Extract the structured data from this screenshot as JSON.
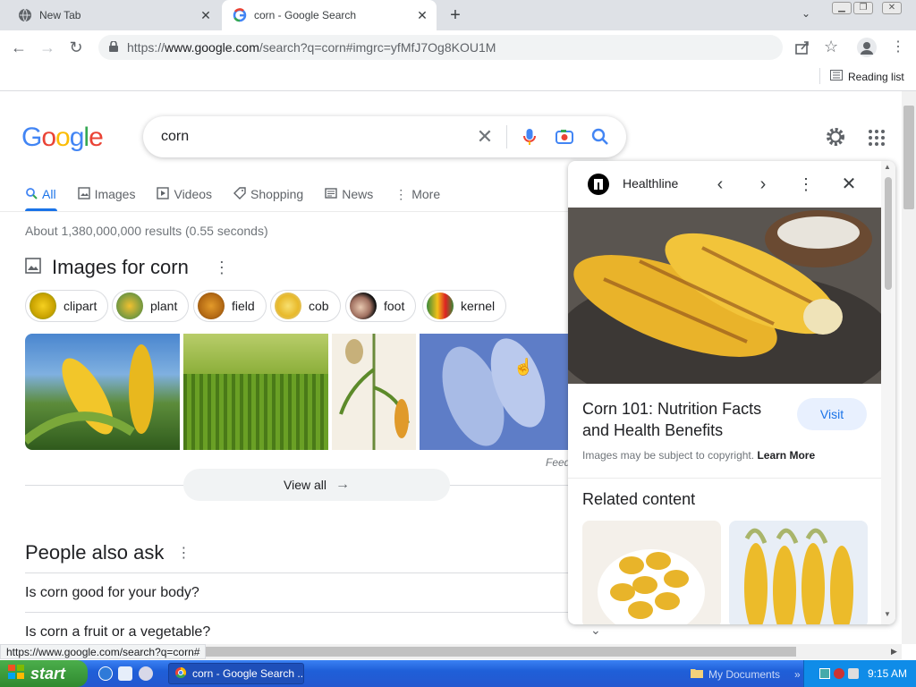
{
  "browser": {
    "tabs": [
      {
        "title": "New Tab"
      },
      {
        "title": "corn - Google Search"
      }
    ],
    "url_prefix": "https://",
    "url_domain": "www.google.com",
    "url_path": "/search?q=corn#imgrc=yfMfJ7Og8KOU1M",
    "reading_list": "Reading list",
    "status_url": "https://www.google.com/search?q=corn#"
  },
  "search": {
    "logo": [
      "G",
      "o",
      "o",
      "g",
      "l",
      "e"
    ],
    "query": "corn",
    "tabs": [
      {
        "label": "All",
        "icon": "search-icon"
      },
      {
        "label": "Images",
        "icon": "image-icon"
      },
      {
        "label": "Videos",
        "icon": "play-icon"
      },
      {
        "label": "Shopping",
        "icon": "tag-icon"
      },
      {
        "label": "News",
        "icon": "news-icon"
      },
      {
        "label": "More",
        "icon": "more-vert-icon"
      }
    ],
    "results_stats": "About 1,380,000,000 results (0.55 seconds)",
    "images_heading": "Images for corn",
    "chips": [
      "clipart",
      "plant",
      "field",
      "cob",
      "foot",
      "kernel"
    ],
    "feedback": "Feed",
    "view_all": "View all",
    "paa_heading": "People also ask",
    "questions": [
      "Is corn good for your body?",
      "Is corn a fruit or a vegetable?"
    ]
  },
  "panel": {
    "source": "Healthline",
    "title": "Corn 101: Nutrition Facts and Health Benefits",
    "visit": "Visit",
    "copyright": "Images may be subject to copyright.",
    "learn_more": "Learn More",
    "related": "Related content"
  },
  "taskbar": {
    "start": "start",
    "task": "corn - Google Search ...",
    "my_documents": "My Documents",
    "clock": "9:15 AM"
  },
  "colors": {
    "google_blue": "#4285f4",
    "google_red": "#ea4335",
    "google_yellow": "#fbbc05",
    "google_green": "#34a853",
    "link_blue": "#1a73e8"
  }
}
